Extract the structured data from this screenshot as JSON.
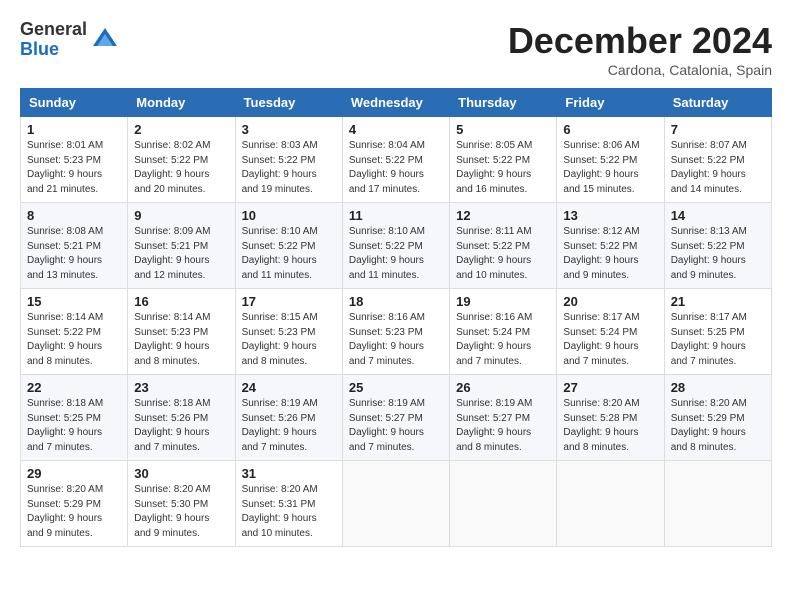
{
  "logo": {
    "general": "General",
    "blue": "Blue"
  },
  "title": "December 2024",
  "subtitle": "Cardona, Catalonia, Spain",
  "days_of_week": [
    "Sunday",
    "Monday",
    "Tuesday",
    "Wednesday",
    "Thursday",
    "Friday",
    "Saturday"
  ],
  "weeks": [
    [
      {
        "day": "1",
        "sunrise": "8:01 AM",
        "sunset": "5:23 PM",
        "daylight_h": "9",
        "daylight_m": "21"
      },
      {
        "day": "2",
        "sunrise": "8:02 AM",
        "sunset": "5:22 PM",
        "daylight_h": "9",
        "daylight_m": "20"
      },
      {
        "day": "3",
        "sunrise": "8:03 AM",
        "sunset": "5:22 PM",
        "daylight_h": "9",
        "daylight_m": "19"
      },
      {
        "day": "4",
        "sunrise": "8:04 AM",
        "sunset": "5:22 PM",
        "daylight_h": "9",
        "daylight_m": "17"
      },
      {
        "day": "5",
        "sunrise": "8:05 AM",
        "sunset": "5:22 PM",
        "daylight_h": "9",
        "daylight_m": "16"
      },
      {
        "day": "6",
        "sunrise": "8:06 AM",
        "sunset": "5:22 PM",
        "daylight_h": "9",
        "daylight_m": "15"
      },
      {
        "day": "7",
        "sunrise": "8:07 AM",
        "sunset": "5:22 PM",
        "daylight_h": "9",
        "daylight_m": "14"
      }
    ],
    [
      {
        "day": "8",
        "sunrise": "8:08 AM",
        "sunset": "5:21 PM",
        "daylight_h": "9",
        "daylight_m": "13"
      },
      {
        "day": "9",
        "sunrise": "8:09 AM",
        "sunset": "5:21 PM",
        "daylight_h": "9",
        "daylight_m": "12"
      },
      {
        "day": "10",
        "sunrise": "8:10 AM",
        "sunset": "5:22 PM",
        "daylight_h": "9",
        "daylight_m": "11"
      },
      {
        "day": "11",
        "sunrise": "8:10 AM",
        "sunset": "5:22 PM",
        "daylight_h": "9",
        "daylight_m": "11"
      },
      {
        "day": "12",
        "sunrise": "8:11 AM",
        "sunset": "5:22 PM",
        "daylight_h": "9",
        "daylight_m": "10"
      },
      {
        "day": "13",
        "sunrise": "8:12 AM",
        "sunset": "5:22 PM",
        "daylight_h": "9",
        "daylight_m": "9"
      },
      {
        "day": "14",
        "sunrise": "8:13 AM",
        "sunset": "5:22 PM",
        "daylight_h": "9",
        "daylight_m": "9"
      }
    ],
    [
      {
        "day": "15",
        "sunrise": "8:14 AM",
        "sunset": "5:22 PM",
        "daylight_h": "9",
        "daylight_m": "8"
      },
      {
        "day": "16",
        "sunrise": "8:14 AM",
        "sunset": "5:23 PM",
        "daylight_h": "9",
        "daylight_m": "8"
      },
      {
        "day": "17",
        "sunrise": "8:15 AM",
        "sunset": "5:23 PM",
        "daylight_h": "9",
        "daylight_m": "8"
      },
      {
        "day": "18",
        "sunrise": "8:16 AM",
        "sunset": "5:23 PM",
        "daylight_h": "9",
        "daylight_m": "7"
      },
      {
        "day": "19",
        "sunrise": "8:16 AM",
        "sunset": "5:24 PM",
        "daylight_h": "9",
        "daylight_m": "7"
      },
      {
        "day": "20",
        "sunrise": "8:17 AM",
        "sunset": "5:24 PM",
        "daylight_h": "9",
        "daylight_m": "7"
      },
      {
        "day": "21",
        "sunrise": "8:17 AM",
        "sunset": "5:25 PM",
        "daylight_h": "9",
        "daylight_m": "7"
      }
    ],
    [
      {
        "day": "22",
        "sunrise": "8:18 AM",
        "sunset": "5:25 PM",
        "daylight_h": "9",
        "daylight_m": "7"
      },
      {
        "day": "23",
        "sunrise": "8:18 AM",
        "sunset": "5:26 PM",
        "daylight_h": "9",
        "daylight_m": "7"
      },
      {
        "day": "24",
        "sunrise": "8:19 AM",
        "sunset": "5:26 PM",
        "daylight_h": "9",
        "daylight_m": "7"
      },
      {
        "day": "25",
        "sunrise": "8:19 AM",
        "sunset": "5:27 PM",
        "daylight_h": "9",
        "daylight_m": "7"
      },
      {
        "day": "26",
        "sunrise": "8:19 AM",
        "sunset": "5:27 PM",
        "daylight_h": "9",
        "daylight_m": "8"
      },
      {
        "day": "27",
        "sunrise": "8:20 AM",
        "sunset": "5:28 PM",
        "daylight_h": "9",
        "daylight_m": "8"
      },
      {
        "day": "28",
        "sunrise": "8:20 AM",
        "sunset": "5:29 PM",
        "daylight_h": "9",
        "daylight_m": "8"
      }
    ],
    [
      {
        "day": "29",
        "sunrise": "8:20 AM",
        "sunset": "5:29 PM",
        "daylight_h": "9",
        "daylight_m": "9"
      },
      {
        "day": "30",
        "sunrise": "8:20 AM",
        "sunset": "5:30 PM",
        "daylight_h": "9",
        "daylight_m": "9"
      },
      {
        "day": "31",
        "sunrise": "8:20 AM",
        "sunset": "5:31 PM",
        "daylight_h": "9",
        "daylight_m": "10"
      },
      null,
      null,
      null,
      null
    ]
  ],
  "labels": {
    "sunrise": "Sunrise:",
    "sunset": "Sunset:",
    "daylight": "Daylight:",
    "hours": "hours",
    "and": "and",
    "minutes": "minutes."
  }
}
